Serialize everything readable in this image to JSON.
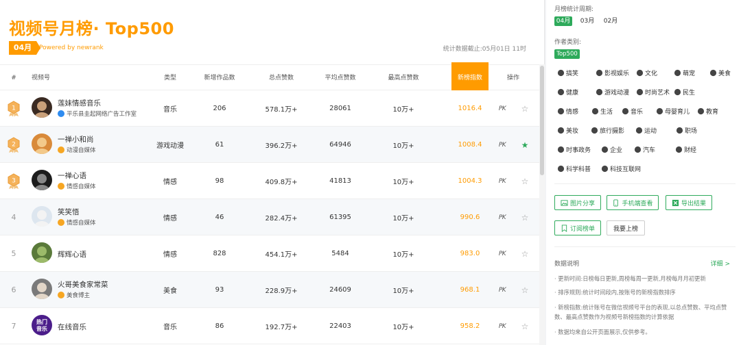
{
  "header": {
    "title": "视频号月榜· Top500",
    "month_badge": "04月",
    "powered": "Powered by newrank",
    "deadline": "统计数据截止:05月01日 11时"
  },
  "columns": [
    "#",
    "视频号",
    "类型",
    "新增作品数",
    "总点赞数",
    "平均点赞数",
    "最高点赞数",
    "新榜指数",
    "操作"
  ],
  "rows": [
    {
      "rank": "1",
      "name": "莲妹情感音乐",
      "sub": "平乐县圭起网络广告工作室",
      "verify": "blue",
      "type": "音乐",
      "new": "206",
      "total": "578.1万+",
      "avg": "28061",
      "max": "10万+",
      "score": "1016.4",
      "starred": false
    },
    {
      "rank": "2",
      "name": "一禅小和尚",
      "sub": "动漫自媒体",
      "verify": "orange",
      "type": "游戏动漫",
      "new": "61",
      "total": "396.2万+",
      "avg": "64946",
      "max": "10万+",
      "score": "1008.4",
      "starred": true
    },
    {
      "rank": "3",
      "name": "一禅心语",
      "sub": "情感自媒体",
      "verify": "orange",
      "type": "情感",
      "new": "98",
      "total": "409.8万+",
      "avg": "41813",
      "max": "10万+",
      "score": "1004.3",
      "starred": false
    },
    {
      "rank": "4",
      "name": "笑笑悟",
      "sub": "情感自媒体",
      "verify": "orange",
      "type": "情感",
      "new": "46",
      "total": "282.4万+",
      "avg": "61395",
      "max": "10万+",
      "score": "990.6",
      "starred": false
    },
    {
      "rank": "5",
      "name": "辉辉心语",
      "sub": "",
      "verify": "",
      "type": "情感",
      "new": "828",
      "total": "454.1万+",
      "avg": "5484",
      "max": "10万+",
      "score": "983.0",
      "starred": false
    },
    {
      "rank": "6",
      "name": "火哥美食家常菜",
      "sub": "美食博主",
      "verify": "orange",
      "type": "美食",
      "new": "93",
      "total": "228.9万+",
      "avg": "24609",
      "max": "10万+",
      "score": "968.1",
      "starred": false
    },
    {
      "rank": "7",
      "name": "在线音乐",
      "sub": "",
      "verify": "",
      "type": "音乐",
      "new": "86",
      "total": "192.7万+",
      "avg": "22403",
      "max": "10万+",
      "score": "958.2",
      "starred": false
    }
  ],
  "avatar_text": {
    "hot1": "热门",
    "hot2": "音乐"
  },
  "pk_label": "PK",
  "star_glyph": "☆",
  "star_on_glyph": "★",
  "sidebar": {
    "period_label": "月榜统计周期:",
    "periods": [
      "04月",
      "03月",
      "02月"
    ],
    "category_label": "作者类别:",
    "category_tag": "Top500",
    "categories": [
      "搞笑",
      "影视娱乐",
      "文化",
      "萌宠",
      "美食",
      "健康",
      "游戏动漫",
      "时尚艺术",
      "民生",
      "情感",
      "生活",
      "音乐",
      "母婴育儿",
      "教育",
      "美妆",
      "旅行摄影",
      "运动",
      "职场",
      "时事政务",
      "企业",
      "汽车",
      "财经",
      "科学科普",
      "科技互联网"
    ],
    "buttons": [
      "图片分享",
      "手机端查看",
      "导出结果",
      "订阅榜单",
      "我要上榜"
    ],
    "info_title": "数据说明",
    "detail": "详细 >",
    "info": [
      "· 更新时间:日榜每日更新,周榜每周一更新,月榜每月月初更新",
      "· 排序规则:统计时间段内,按账号的新榜指数排序",
      "· 新榜指数:统计账号在微信视频号平台的表现,以总点赞数、平均点赞数、最高点赞数作为视频号新榜指数的计算依据",
      "· 数据均来自公开页面展示,仅供参考。"
    ]
  },
  "colors": {
    "accent": "#ff9b00",
    "green": "#2eaa5b"
  }
}
